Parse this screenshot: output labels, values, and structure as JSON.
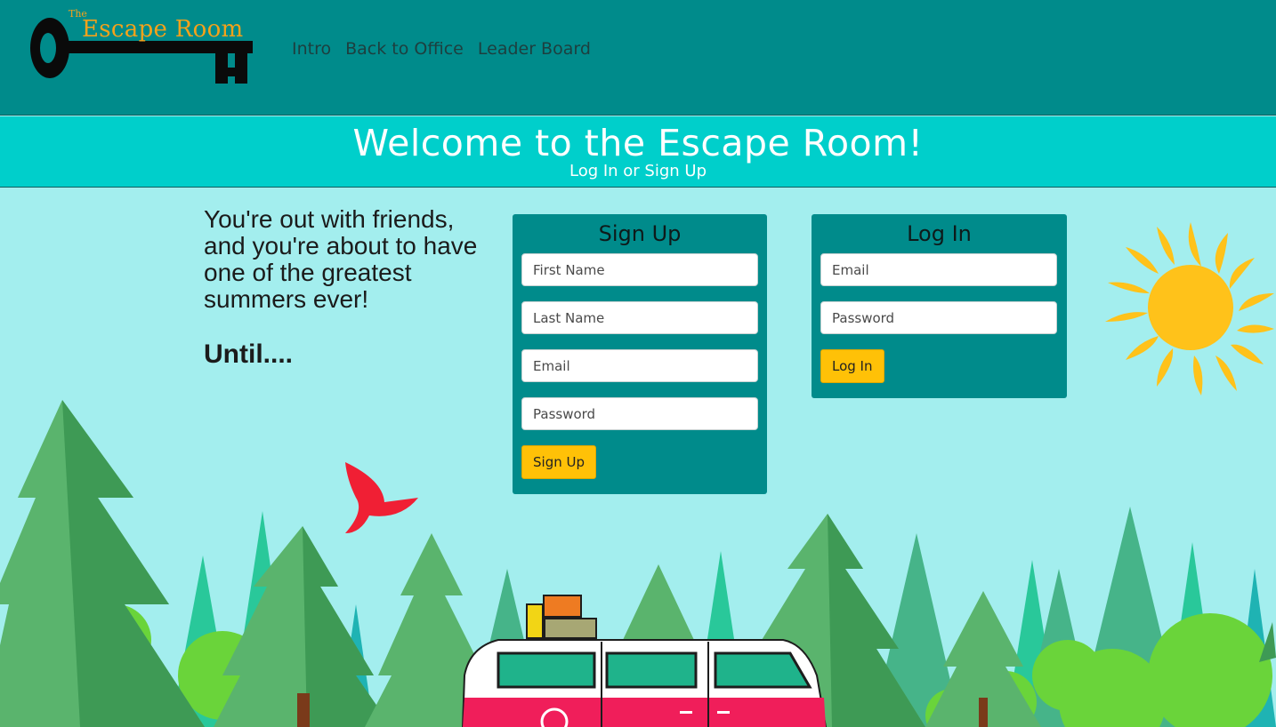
{
  "nav": {
    "logo_small": "The",
    "logo_big": "Escape Room",
    "links": [
      "Intro",
      "Back to Office",
      "Leader Board"
    ]
  },
  "banner": {
    "title": "Welcome to the Escape Room!",
    "subtitle": "Log In or Sign Up"
  },
  "intro": {
    "text": "You're out with friends, and you're about to have one of the greatest summers ever!",
    "until": "Until...."
  },
  "signup": {
    "title": "Sign Up",
    "first_name_placeholder": "First Name",
    "last_name_placeholder": "Last Name",
    "email_placeholder": "Email",
    "password_placeholder": "Password",
    "button": "Sign Up"
  },
  "login": {
    "title": "Log In",
    "email_placeholder": "Email",
    "password_placeholder": "Password",
    "button": "Log In"
  },
  "colors": {
    "navbar": "#008b8b",
    "banner": "#00cfcb",
    "background": "#a3eeee",
    "accent_button": "#ffc107",
    "logo_text": "#f5a21a"
  },
  "icons": [
    "key-logo-icon",
    "sun-illustration",
    "bird-illustration",
    "camper-van-illustration",
    "pine-tree-illustration"
  ]
}
